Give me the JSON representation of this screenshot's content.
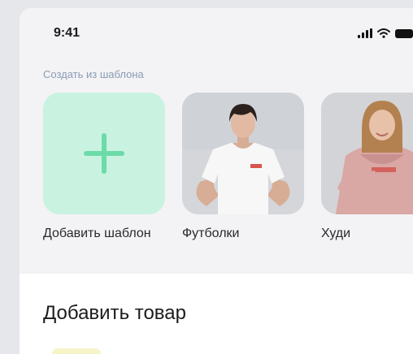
{
  "status_bar": {
    "time": "9:41",
    "icons": [
      "signal-icon",
      "wifi-icon",
      "battery-icon"
    ]
  },
  "templates": {
    "caption": "Создать из шаблона",
    "items": [
      {
        "label": "Добавить шаблон",
        "icon": "plus-icon"
      },
      {
        "label": "Футболки",
        "image": "tshirt-model-photo"
      },
      {
        "label": "Худи",
        "image": "hoodie-model-photo"
      }
    ]
  },
  "add_product": {
    "title": "Добавить товар"
  },
  "colors": {
    "accent_green": "#6bdba8",
    "add_tile_bg": "#c9f2e1",
    "caption_blue": "#8a9bb5"
  }
}
